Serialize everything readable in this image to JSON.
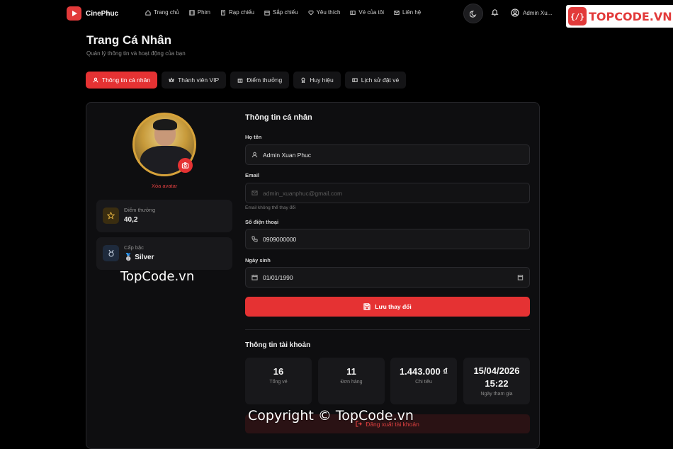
{
  "brand": {
    "name": "CinePhuc"
  },
  "nav": [
    {
      "label": "Trang chủ",
      "icon": "home-icon"
    },
    {
      "label": "Phim",
      "icon": "film-icon"
    },
    {
      "label": "Rạp chiếu",
      "icon": "building-icon"
    },
    {
      "label": "Sắp chiếu",
      "icon": "calendar-icon"
    },
    {
      "label": "Yêu thích",
      "icon": "heart-icon"
    },
    {
      "label": "Vé của tôi",
      "icon": "ticket-icon"
    },
    {
      "label": "Liên hệ",
      "icon": "mail-icon"
    }
  ],
  "user": {
    "name": "Admin Xu..."
  },
  "watermark": {
    "logo_text": "TOPCODE.VN",
    "site": "TopCode.vn",
    "copyright": "Copyright © TopCode.vn"
  },
  "page": {
    "title": "Trang Cá Nhân",
    "subtitle": "Quản lý thông tin và hoạt động của bạn"
  },
  "tabs": [
    {
      "label": "Thông tin cá nhân",
      "active": true
    },
    {
      "label": "Thành viên VIP",
      "active": false
    },
    {
      "label": "Điểm thưởng",
      "active": false
    },
    {
      "label": "Huy hiệu",
      "active": false
    },
    {
      "label": "Lịch sử đặt vé",
      "active": false
    }
  ],
  "profile": {
    "remove_avatar": "Xóa avatar",
    "points_label": "Điểm thưởng",
    "points_value": "40,2",
    "tier_label": "Cấp bậc",
    "tier_value": "🥈 Silver"
  },
  "form": {
    "title": "Thông tin cá nhân",
    "name_label": "Họ tên",
    "name_value": "Admin Xuan Phuc",
    "email_label": "Email",
    "email_value": "admin_xuanphuc@gmail.com",
    "email_hint": "Email không thể thay đổi",
    "phone_label": "Số điện thoại",
    "phone_value": "0909000000",
    "dob_label": "Ngày sinh",
    "dob_value": "01/01/1990",
    "save_label": "Lưu thay đổi"
  },
  "account": {
    "title": "Thông tin tài khoản",
    "stats": [
      {
        "value": "16",
        "label": "Tổng vé"
      },
      {
        "value": "11",
        "label": "Đơn hàng"
      },
      {
        "value": "1.443.000 ₫",
        "label": "Chi tiêu"
      },
      {
        "value": "15/04/2026 15:22",
        "label": "Ngày tham gia"
      }
    ],
    "logout_label": "Đăng xuất tài khoản"
  },
  "colors": {
    "accent": "#e53233",
    "gold": "#d6a23a"
  }
}
